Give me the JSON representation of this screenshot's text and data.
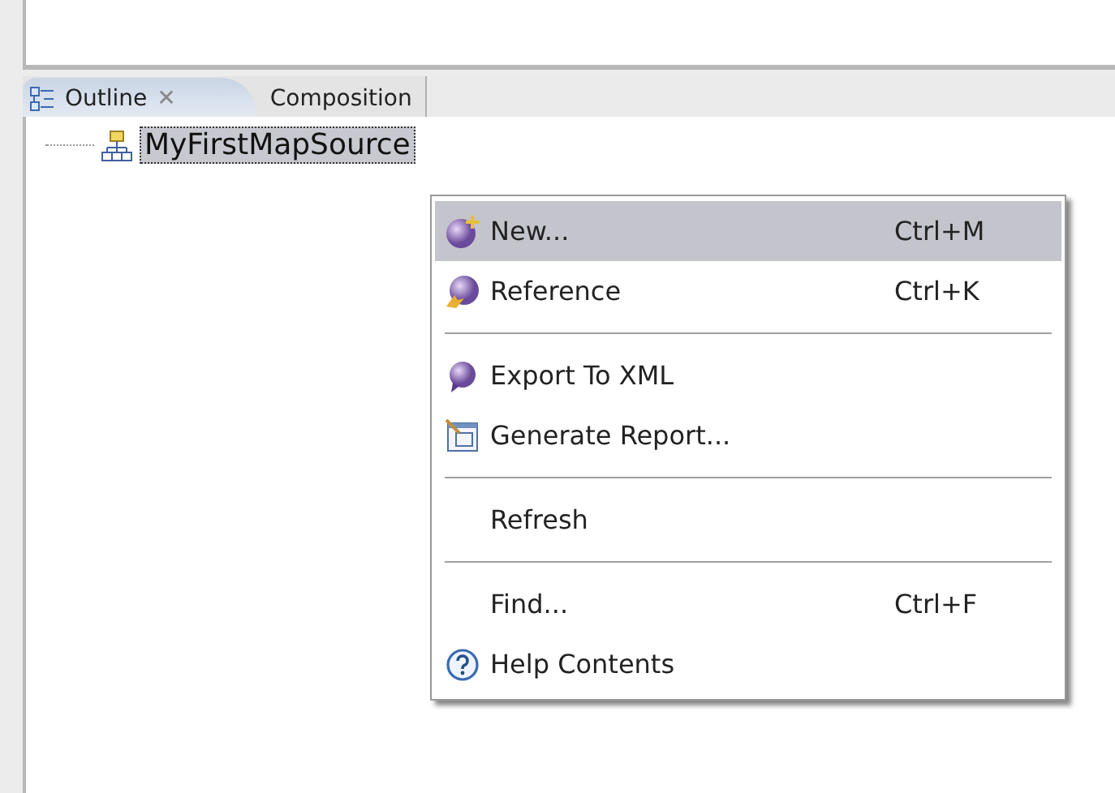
{
  "tabs": [
    {
      "label": "Outline",
      "selected": true,
      "close": "✕"
    },
    {
      "label": "Composition",
      "selected": false
    }
  ],
  "tree": {
    "items": [
      {
        "label": "MyFirstMapSource",
        "selected": true
      }
    ]
  },
  "context_menu": {
    "items": [
      {
        "kind": "item",
        "label": "New...",
        "shortcut": "Ctrl+M",
        "selected": true
      },
      {
        "kind": "item",
        "label": "Reference",
        "shortcut": "Ctrl+K",
        "selected": false
      },
      {
        "kind": "separator"
      },
      {
        "kind": "item",
        "label": "Export To XML",
        "selected": false
      },
      {
        "kind": "item",
        "label": "Generate Report...",
        "selected": false
      },
      {
        "kind": "separator"
      },
      {
        "kind": "item",
        "label": "Refresh",
        "selected": false
      },
      {
        "kind": "separator"
      },
      {
        "kind": "item",
        "label": "Find...",
        "shortcut": "Ctrl+F",
        "selected": false
      },
      {
        "kind": "item",
        "label": "Help Contents",
        "selected": false
      }
    ]
  }
}
